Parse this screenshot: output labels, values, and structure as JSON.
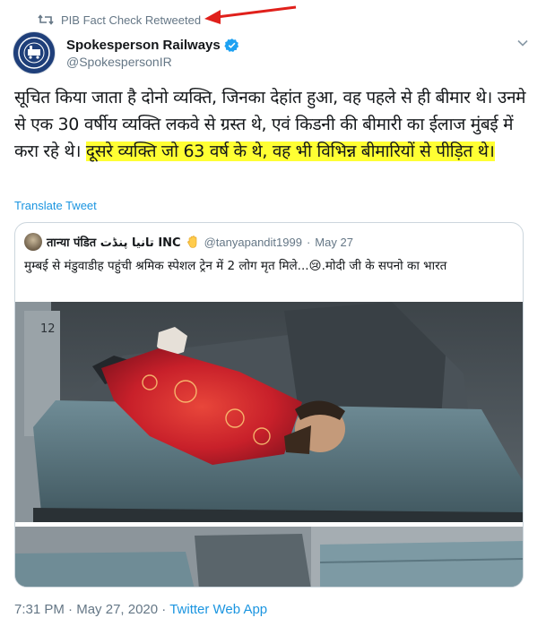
{
  "retweet_bar": {
    "icon": "retweet-icon",
    "label": "PIB Fact Check Retweeted"
  },
  "author": {
    "name": "Spokesperson Railways",
    "handle": "@SpokespersonIR",
    "verified": true,
    "avatar_icon": "indian-railways-logo"
  },
  "tweet": {
    "text_plain": "सूचित किया जाता है दोनो व्यक्ति, जिनका देहांत हुआ, वह पहले से ही बीमार थे। उनमे से एक 30 वर्षीय व्यक्ति लकवे से ग्रस्त थे, एवं किडनी की बीमारी का ईलाज मुंबई में करा रहे थे। ",
    "text_highlighted": "दूसरे व्यक्ति जो 63 वर्ष के थे, वह भी विभिन्न बीमारियों से पीड़ित थे।",
    "highlight_color": "#ffff33",
    "translate_label": "Translate Tweet"
  },
  "quote": {
    "name": "तान्या पंडित تانیا پنڈت INC",
    "emoji_icon": "raised-hand-icon",
    "handle": "@tanyapandit1999",
    "separator": "·",
    "date": "May 27",
    "text": "मुम्बई से  मंडुवाडीह पहुंची श्रमिक स्पेशल ट्रेन में 2 लोग मृत मिले...😢.मोदी जी के सपनो का भारत",
    "image_main_icon": "train-berth-photo",
    "image_secondary_icon": "train-seat-photo",
    "berth_number": "12"
  },
  "footer": {
    "time": "7:31 PM",
    "separator1": " · ",
    "date": "May 27, 2020",
    "separator2": " · ",
    "app": "Twitter Web App"
  },
  "colors": {
    "link": "#1b95e0",
    "muted": "#657786",
    "annotation_arrow": "#e0201b"
  }
}
